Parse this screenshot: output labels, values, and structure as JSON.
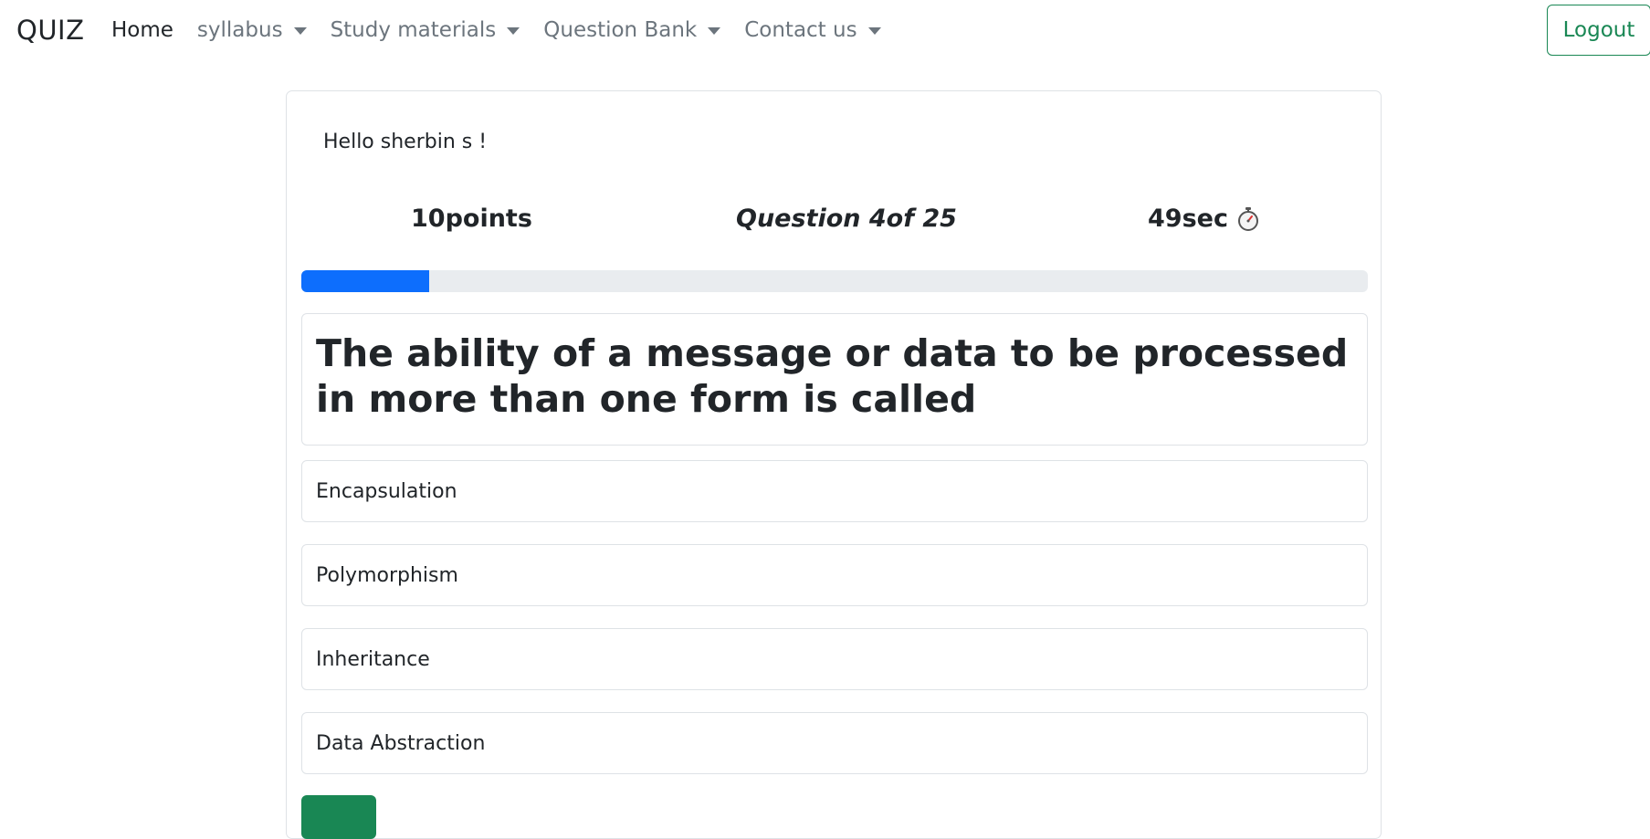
{
  "navbar": {
    "brand": "QUIZ",
    "items": [
      {
        "label": "Home",
        "dropdown": false,
        "active": true
      },
      {
        "label": "syllabus",
        "dropdown": true,
        "active": false
      },
      {
        "label": "Study materials",
        "dropdown": true,
        "active": false
      },
      {
        "label": "Question Bank",
        "dropdown": true,
        "active": false
      },
      {
        "label": "Contact us",
        "dropdown": true,
        "active": false
      }
    ],
    "logout_label": "Logout"
  },
  "quiz": {
    "greeting": "Hello sherbin s !",
    "points": "10points",
    "question_counter": "Question 4of 25",
    "timer": "49sec",
    "timer_icon": "stopwatch-icon",
    "progress_fraction": 0.12,
    "question": "The ability of a message or data to be processed in more than one form is called",
    "options": [
      "Encapsulation",
      "Polymorphism",
      "Inheritance",
      "Data Abstraction"
    ]
  },
  "colors": {
    "primary": "#0d6efd",
    "success": "#198754",
    "muted_nav": "#6c757d",
    "border": "#dee2e6",
    "progress_track": "#e9ecef"
  }
}
